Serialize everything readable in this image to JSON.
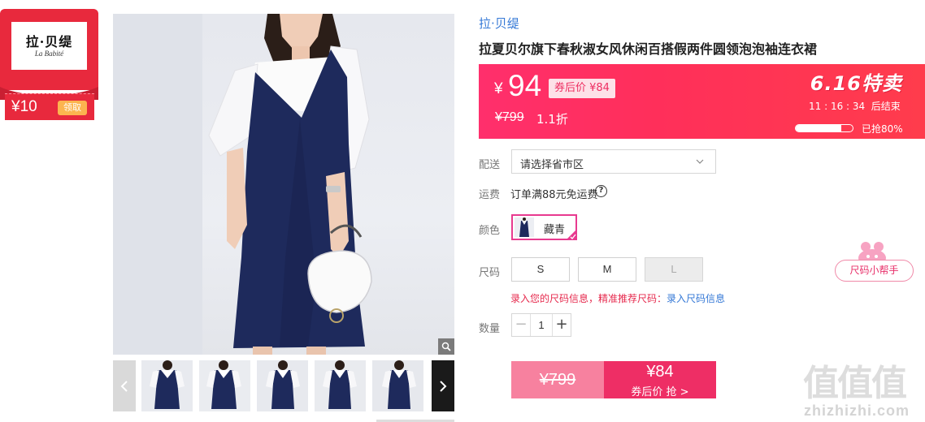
{
  "brand_card": {
    "logo_cn": "拉·贝缇",
    "logo_en": "La Babité",
    "coupon_amount": "¥10",
    "claim_label": "领取"
  },
  "gallery": {
    "thumbnail_count": 5
  },
  "product": {
    "brand_link": "拉·贝缇",
    "title": "拉夏贝尔旗下春秋淑女风休闲百搭假两件圆领泡泡袖连衣裙"
  },
  "price_banner": {
    "currency": "¥",
    "price": "94",
    "after_coupon": "券后价 ¥84",
    "original_price": "¥799",
    "discount": "1.1折",
    "event_title": "6.16特卖",
    "countdown": "11 : 16 : 34  后结束",
    "sold_percent": 80,
    "sold_label": "已抢80%"
  },
  "delivery": {
    "label": "配送",
    "select_value": "请选择省市区"
  },
  "shipping": {
    "label": "运费",
    "text": "订单满88元免运费",
    "help_glyph": "?"
  },
  "color": {
    "label": "颜色",
    "selected": "藏青"
  },
  "size": {
    "label": "尺码",
    "options": [
      {
        "name": "S",
        "available": true
      },
      {
        "name": "M",
        "available": true
      },
      {
        "name": "L",
        "available": false
      }
    ],
    "hint": "录入您的尺码信息，精准推荐尺码：",
    "hint_link": "录入尺码信息",
    "helper_label": "尺码小帮手"
  },
  "quantity": {
    "label": "数量",
    "value": "1",
    "minus": "−",
    "plus": "+"
  },
  "buy": {
    "original_price": "¥799",
    "coupon_price": "¥84",
    "coupon_label": "券后价 抢 >"
  },
  "watermark": {
    "logo": "值值值",
    "site": "zhizhizhi.com"
  },
  "colors": {
    "brand_red": "#e8293d",
    "price_pink": "#ff2f6c",
    "accent_magenta": "#e83a8f",
    "link_blue": "#3478d6"
  }
}
